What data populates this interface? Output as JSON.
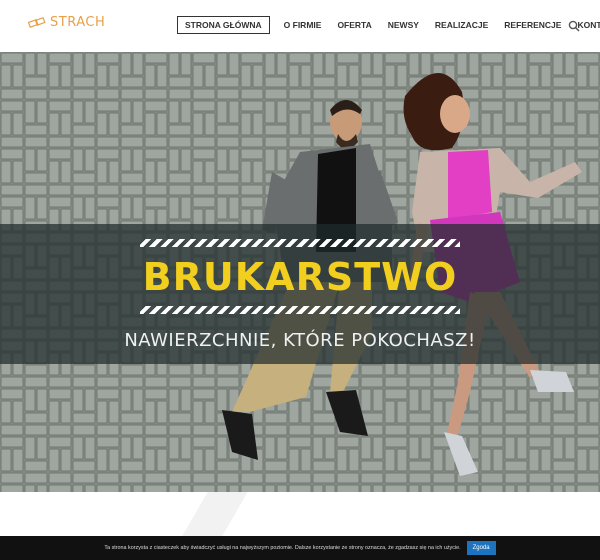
{
  "brand": {
    "name": "STRACH",
    "accent": "#e8a04a"
  },
  "nav": {
    "items": [
      {
        "label": "STRONA GŁÓWNA",
        "active": true
      },
      {
        "label": "O FIRMIE"
      },
      {
        "label": "OFERTA"
      },
      {
        "label": "NEWSY"
      },
      {
        "label": "REALIZACJE"
      },
      {
        "label": "REFERENCJE"
      },
      {
        "label": "KONTAKT"
      }
    ],
    "search_icon": "search-icon"
  },
  "hero": {
    "title": "BRUKARSTWO",
    "subtitle": "NAWIERZCHNIE, KTÓRE POKOCHASZ!",
    "title_color": "#f2cf1f",
    "band_color": "#202c2c"
  },
  "cookie": {
    "text": "Ta strona korzysta z ciasteczek aby świadczyć usługi na najwyższym poziomie. Dalsze korzystanie ze strony oznacza, że zgadzasz się na ich użycie.",
    "button_label": "Zgoda",
    "button_color": "#1e73be"
  }
}
